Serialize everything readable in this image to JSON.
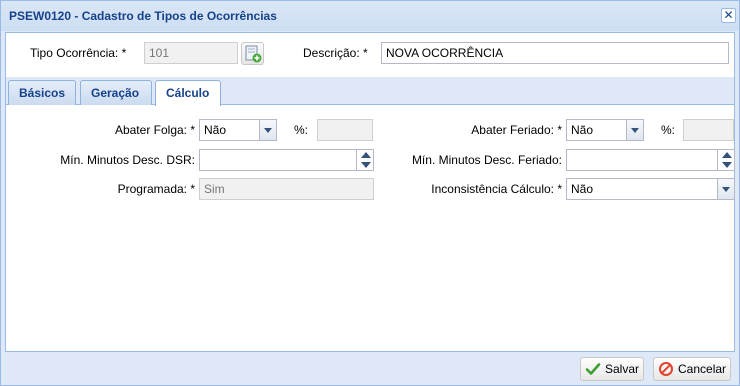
{
  "window": {
    "title": "PSEW0120 - Cadastro de Tipos de Ocorrências",
    "close_label": "✕"
  },
  "header": {
    "tipo_label": "Tipo Ocorrência: *",
    "tipo_value": "101",
    "descricao_label": "Descrição: *",
    "descricao_value": "NOVA OCORRÊNCIA"
  },
  "tabs": [
    {
      "label": "Básicos",
      "active": false
    },
    {
      "label": "Geração",
      "active": false
    },
    {
      "label": "Cálculo",
      "active": true
    }
  ],
  "form": {
    "abater_folga_label": "Abater Folga: *",
    "abater_folga_value": "Não",
    "pct1_label": "%:",
    "pct1_value": "",
    "abater_feriado_label": "Abater Feriado: *",
    "abater_feriado_value": "Não",
    "pct2_label": "%:",
    "pct2_value": "",
    "min_dsr_label": "Mín. Minutos Desc. DSR:",
    "min_dsr_value": "",
    "min_feriado_label": "Mín. Minutos Desc. Feriado:",
    "min_feriado_value": "",
    "programada_label": "Programada: *",
    "programada_value": "Sim",
    "inconsistencia_label": "Inconsistência Cálculo: *",
    "inconsistencia_value": "Não"
  },
  "footer": {
    "save_label": "Salvar",
    "cancel_label": "Cancelar"
  },
  "colors": {
    "title_text": "#15428b",
    "panel_border": "#99bbe8",
    "save_icon": "#3c9e2e",
    "cancel_icon": "#e0422d"
  },
  "icons": {
    "lookup": "new-record-icon",
    "save": "check-icon",
    "cancel": "cancel-icon"
  }
}
